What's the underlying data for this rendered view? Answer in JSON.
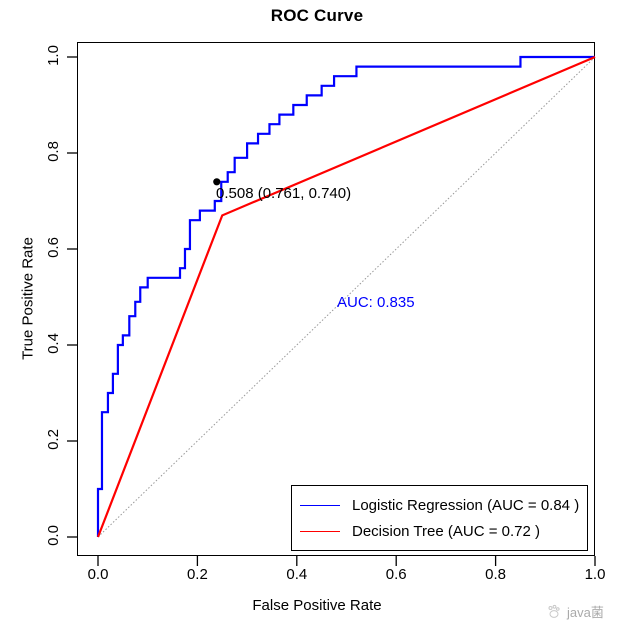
{
  "chart_data": {
    "type": "line",
    "title": "ROC Curve",
    "xlabel": "False Positive Rate",
    "ylabel": "True Positive Rate",
    "xlim": [
      0,
      1
    ],
    "ylim": [
      0,
      1
    ],
    "xticks": [
      "0.0",
      "0.2",
      "0.4",
      "0.6",
      "0.8",
      "1.0"
    ],
    "yticks": [
      "0.0",
      "0.2",
      "0.4",
      "0.6",
      "0.8",
      "1.0"
    ],
    "xtick_values": [
      0.0,
      0.2,
      0.4,
      0.6,
      0.8,
      1.0
    ],
    "ytick_values": [
      0.0,
      0.2,
      0.4,
      0.6,
      0.8,
      1.0
    ],
    "grid": false,
    "legend_position": "bottom-right",
    "series": [
      {
        "name": "Logistic Regression (AUC = 0.84 )",
        "color": "#0000ff",
        "style": "step",
        "auc": 0.84,
        "points": [
          [
            0.0,
            0.0
          ],
          [
            0.0,
            0.1
          ],
          [
            0.008,
            0.1
          ],
          [
            0.008,
            0.26
          ],
          [
            0.02,
            0.26
          ],
          [
            0.02,
            0.3
          ],
          [
            0.03,
            0.3
          ],
          [
            0.03,
            0.34
          ],
          [
            0.04,
            0.34
          ],
          [
            0.04,
            0.4
          ],
          [
            0.05,
            0.4
          ],
          [
            0.05,
            0.42
          ],
          [
            0.063,
            0.42
          ],
          [
            0.063,
            0.46
          ],
          [
            0.075,
            0.46
          ],
          [
            0.075,
            0.49
          ],
          [
            0.085,
            0.49
          ],
          [
            0.085,
            0.52
          ],
          [
            0.1,
            0.52
          ],
          [
            0.1,
            0.54
          ],
          [
            0.165,
            0.54
          ],
          [
            0.165,
            0.56
          ],
          [
            0.175,
            0.56
          ],
          [
            0.175,
            0.6
          ],
          [
            0.185,
            0.6
          ],
          [
            0.185,
            0.66
          ],
          [
            0.205,
            0.66
          ],
          [
            0.205,
            0.68
          ],
          [
            0.235,
            0.68
          ],
          [
            0.235,
            0.7
          ],
          [
            0.248,
            0.7
          ],
          [
            0.248,
            0.74
          ],
          [
            0.261,
            0.74
          ],
          [
            0.261,
            0.76
          ],
          [
            0.275,
            0.76
          ],
          [
            0.275,
            0.79
          ],
          [
            0.3,
            0.79
          ],
          [
            0.3,
            0.82
          ],
          [
            0.322,
            0.82
          ],
          [
            0.322,
            0.84
          ],
          [
            0.345,
            0.84
          ],
          [
            0.345,
            0.86
          ],
          [
            0.365,
            0.86
          ],
          [
            0.365,
            0.88
          ],
          [
            0.393,
            0.88
          ],
          [
            0.393,
            0.9
          ],
          [
            0.42,
            0.9
          ],
          [
            0.42,
            0.92
          ],
          [
            0.45,
            0.92
          ],
          [
            0.45,
            0.94
          ],
          [
            0.475,
            0.94
          ],
          [
            0.475,
            0.96
          ],
          [
            0.52,
            0.96
          ],
          [
            0.52,
            0.98
          ],
          [
            0.85,
            0.98
          ],
          [
            0.85,
            1.0
          ],
          [
            1.0,
            1.0
          ]
        ]
      },
      {
        "name": "Decision Tree (AUC = 0.72 )",
        "color": "#ff0000",
        "style": "linear",
        "auc": 0.72,
        "points": [
          [
            0.0,
            0.0
          ],
          [
            0.25,
            0.67
          ],
          [
            1.0,
            1.0
          ]
        ]
      }
    ],
    "reference_line": {
      "name": "chance-diagonal",
      "color": "#999999",
      "style": "dotted",
      "points": [
        [
          0.0,
          0.0
        ],
        [
          1.0,
          1.0
        ]
      ]
    },
    "annotations": [
      {
        "name": "threshold-point",
        "text": "0.508 (0.761, 0.740)",
        "color": "#000000",
        "marker": "dot",
        "marker_color": "#000000",
        "marker_x": 0.239,
        "marker_y": 0.74,
        "threshold": 0.508,
        "specificity": 0.761,
        "sensitivity": 0.74
      },
      {
        "name": "auc-label",
        "text": "AUC: 0.835",
        "color": "#0000ff",
        "value": 0.835
      }
    ]
  },
  "legend": {
    "items": [
      {
        "label": "Logistic Regression (AUC = 0.84 )",
        "color": "#0000ff"
      },
      {
        "label": "Decision Tree (AUC = 0.72 )",
        "color": "#ff0000"
      }
    ]
  },
  "watermark": {
    "text": "java菌",
    "icon": "paw-logo-icon"
  }
}
